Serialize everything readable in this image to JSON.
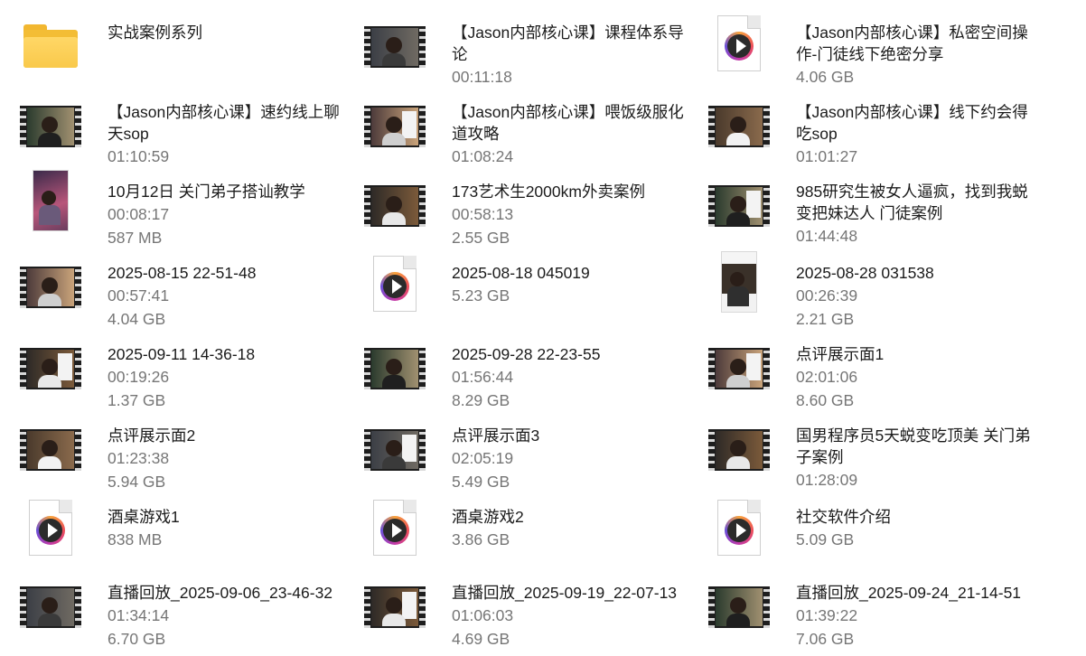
{
  "items": [
    {
      "name": "实战案例系列",
      "line2": "",
      "line3": "",
      "icon": "folder-icon"
    },
    {
      "name": "【Jason内部核心课】课程体系导论",
      "line2": "00:11:18",
      "line3": "",
      "icon": "video-thumbnail"
    },
    {
      "name": "【Jason内部核心课】私密空间操作-门徒线下绝密分享",
      "line2": "4.06 GB",
      "line3": "",
      "icon": "video-file-icon"
    },
    {
      "name": "【Jason内部核心课】速约线上聊天sop",
      "line2": "01:10:59",
      "line3": "",
      "icon": "video-thumbnail"
    },
    {
      "name": "【Jason内部核心课】喂饭级服化道攻略",
      "line2": "01:08:24",
      "line3": "",
      "icon": "video-thumbnail"
    },
    {
      "name": "【Jason内部核心课】线下约会得吃sop",
      "line2": "01:01:27",
      "line3": "",
      "icon": "video-thumbnail"
    },
    {
      "name": "10月12日 关门弟子搭讪教学",
      "line2": "00:08:17",
      "line3": "587 MB",
      "icon": "portrait-thumbnail"
    },
    {
      "name": "173艺术生2000km外卖案例",
      "line2": "00:58:13",
      "line3": "2.55 GB",
      "icon": "video-thumbnail"
    },
    {
      "name": "985研究生被女人逼疯，找到我蜕变把妹达人 门徒案例",
      "line2": "01:44:48",
      "line3": "",
      "icon": "video-thumbnail"
    },
    {
      "name": "2025-08-15 22-51-48",
      "line2": "00:57:41",
      "line3": "4.04 GB",
      "icon": "video-thumbnail"
    },
    {
      "name": "2025-08-18 045019",
      "line2": "5.23 GB",
      "line3": "",
      "icon": "video-file-icon"
    },
    {
      "name": "2025-08-28 031538",
      "line2": "00:26:39",
      "line3": "2.21 GB",
      "icon": "phone-thumbnail"
    },
    {
      "name": "2025-09-11 14-36-18",
      "line2": "00:19:26",
      "line3": "1.37 GB",
      "icon": "video-thumbnail"
    },
    {
      "name": "2025-09-28 22-23-55",
      "line2": "01:56:44",
      "line3": "8.29 GB",
      "icon": "video-thumbnail"
    },
    {
      "name": "点评展示面1",
      "line2": "02:01:06",
      "line3": "8.60 GB",
      "icon": "video-thumbnail"
    },
    {
      "name": "点评展示面2",
      "line2": "01:23:38",
      "line3": "5.94 GB",
      "icon": "video-thumbnail"
    },
    {
      "name": "点评展示面3",
      "line2": "02:05:19",
      "line3": "5.49 GB",
      "icon": "video-thumbnail"
    },
    {
      "name": "国男程序员5天蜕变吃顶美 关门弟子案例",
      "line2": "01:28:09",
      "line3": "",
      "icon": "video-thumbnail"
    },
    {
      "name": "酒桌游戏1",
      "line2": "838 MB",
      "line3": "",
      "icon": "video-file-icon"
    },
    {
      "name": "酒桌游戏2",
      "line2": "3.86 GB",
      "line3": "",
      "icon": "video-file-icon"
    },
    {
      "name": "社交软件介绍",
      "line2": "5.09 GB",
      "line3": "",
      "icon": "video-file-icon"
    },
    {
      "name": "直播回放_2025-09-06_23-46-32",
      "line2": "01:34:14",
      "line3": "6.70 GB",
      "icon": "video-thumbnail"
    },
    {
      "name": "直播回放_2025-09-19_22-07-13",
      "line2": "01:06:03",
      "line3": "4.69 GB",
      "icon": "video-thumbnail"
    },
    {
      "name": "直播回放_2025-09-24_21-14-51",
      "line2": "01:39:22",
      "line3": "7.06 GB",
      "icon": "video-thumbnail"
    }
  ]
}
